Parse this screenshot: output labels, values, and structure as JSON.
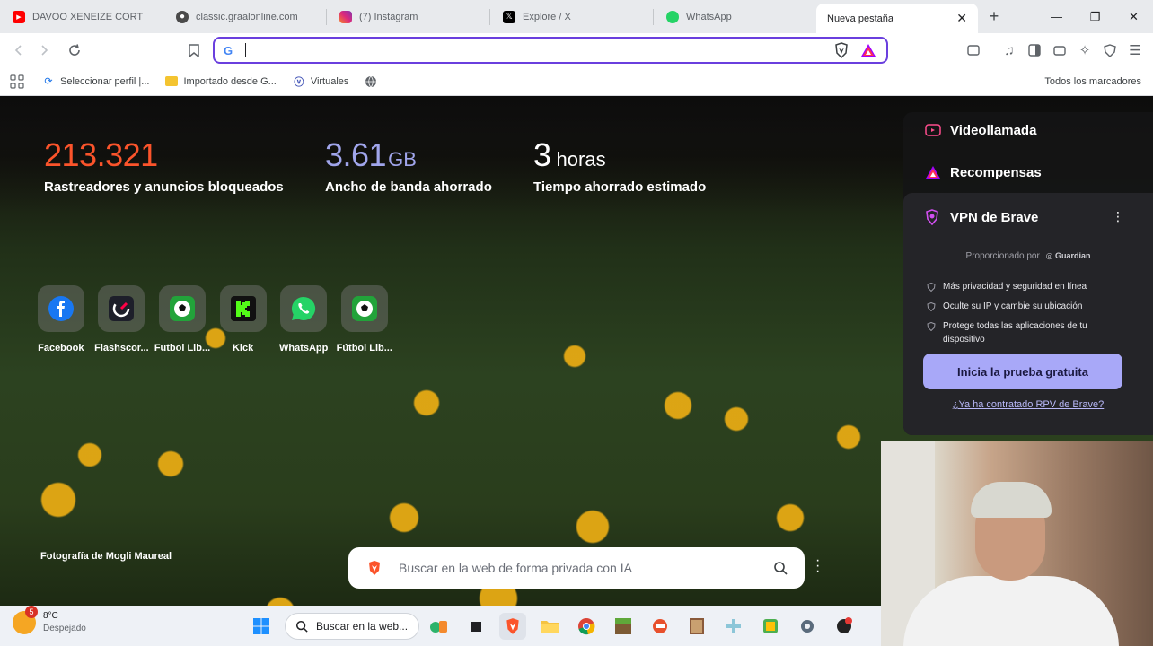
{
  "tabs": [
    {
      "label": "DAVOO XENEIZE CORT",
      "icon": "youtube-icon"
    },
    {
      "label": "classic.graalonline.com",
      "icon": "graal-icon"
    },
    {
      "label": "(7) Instagram",
      "icon": "instagram-icon"
    },
    {
      "label": "Explore / X",
      "icon": "x-icon"
    },
    {
      "label": "WhatsApp",
      "icon": "whatsapp-icon"
    }
  ],
  "active_tab": {
    "label": "Nueva pestaña",
    "close": "✕"
  },
  "new_tab": "+",
  "window_controls": {
    "minimize": "—",
    "maximize": "❐",
    "close": "✕"
  },
  "omnibox": {
    "value": "",
    "placeholder": ""
  },
  "bookmarks": [
    {
      "label": "Seleccionar perfil |...",
      "icon": "profile-icon"
    },
    {
      "label": "Importado desde G...",
      "icon": "folder-icon"
    },
    {
      "label": "Virtuales",
      "icon": "virtuales-icon"
    }
  ],
  "bookmarks_right": {
    "label": "Todos los marcadores",
    "icon": "folder-icon"
  },
  "stats": [
    {
      "value": "213.321",
      "unit": "",
      "label": "Rastreadores y anuncios bloqueados",
      "color": "#fb542b"
    },
    {
      "value": "3.61",
      "unit": "GB",
      "label": "Ancho de banda ahorrado",
      "color": "#a0a5eb"
    },
    {
      "value": "3",
      "unit": "horas",
      "label": "Tiempo ahorrado estimado",
      "color": "#ffffff"
    }
  ],
  "tiles": [
    {
      "label": "Facebook",
      "icon": "facebook-icon"
    },
    {
      "label": "Flashscor...",
      "icon": "flashscore-icon"
    },
    {
      "label": "Futbol Lib...",
      "icon": "soccer-ball-icon"
    },
    {
      "label": "Kick",
      "icon": "kick-icon"
    },
    {
      "label": "WhatsApp",
      "icon": "whatsapp-icon"
    },
    {
      "label": "Fútbol Lib...",
      "icon": "soccer-ball-icon"
    }
  ],
  "photo_credit": "Fotografía de Mogli Maureal",
  "search": {
    "placeholder": "Buscar en la web de forma privada con IA"
  },
  "panel": {
    "videocall": "Videollamada",
    "rewards": "Recompensas",
    "vpn_title": "VPN de Brave",
    "provided_by": "Proporcionado por",
    "provider": "Guardian",
    "bullets": [
      "Más privacidad y seguridad en línea",
      "Oculte su IP y cambie su ubicación",
      "Protege todas las aplicaciones de tu dispositivo"
    ],
    "cta": "Inicia la prueba gratuita",
    "link": "¿Ya ha contratado RPV de Brave?"
  },
  "taskbar": {
    "weather_temp": "8°C",
    "weather_desc": "Despejado",
    "weather_badge": "5",
    "search_label": "Buscar en la web..."
  }
}
